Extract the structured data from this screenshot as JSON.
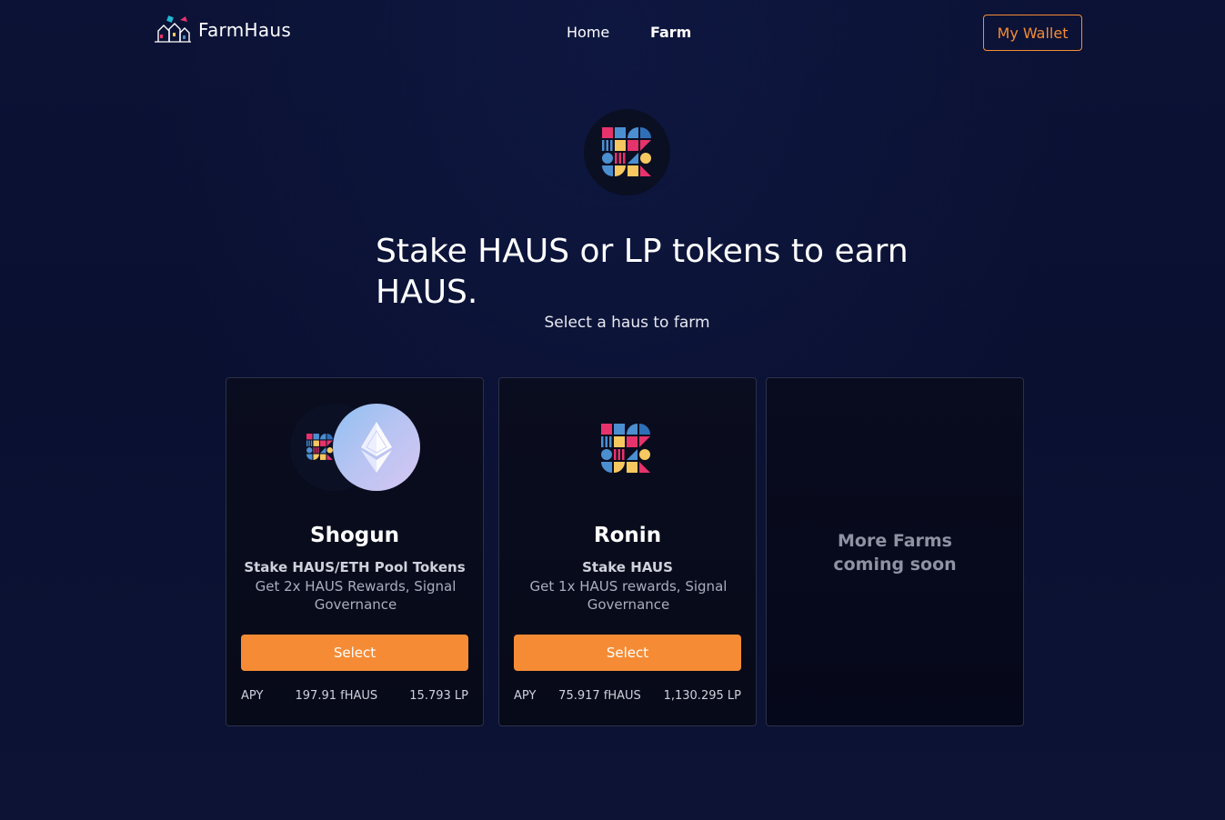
{
  "header": {
    "brand": "FarmHaus",
    "nav": [
      {
        "label": "Home",
        "active": false
      },
      {
        "label": "Farm",
        "active": true
      }
    ],
    "wallet_button": "My Wallet"
  },
  "hero": {
    "headline": "Stake HAUS or LP tokens to earn HAUS.",
    "subheading": "Select a haus to farm"
  },
  "farms": [
    {
      "name": "Shogun",
      "stake": "Stake HAUS/ETH Pool Tokens",
      "description": "Get 2x HAUS Rewards, Signal Governance",
      "button": "Select",
      "apy_label": "APY",
      "reward": "197.91 fHAUS",
      "liquidity": "15.793 LP"
    },
    {
      "name": "Ronin",
      "stake": "Stake HAUS",
      "description": "Get 1x HAUS rewards, Signal Governance",
      "button": "Select",
      "apy_label": "APY",
      "reward": "75.917 fHAUS",
      "liquidity": "1,130.295 LP"
    }
  ],
  "coming_soon": "More Farms coming soon",
  "colors": {
    "accent": "#f58c35",
    "background": "#0a1030",
    "card": "#080b1c"
  }
}
